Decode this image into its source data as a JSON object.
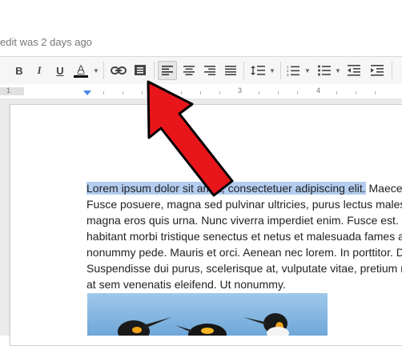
{
  "header": {
    "last_edit": "edit was 2 days ago"
  },
  "toolbar": {
    "bold_label": "B",
    "italic_label": "I",
    "underline_label": "U",
    "text_color_label": "A",
    "text_color_bar": "#000000"
  },
  "ruler": {
    "numbers": [
      "1",
      "1",
      "2",
      "3",
      "4"
    ]
  },
  "document": {
    "selected_text": "Lorem ipsum dolor sit amet, consectetuer adipiscing elit.",
    "line1_rest": " Maecenas",
    "lines": [
      "Fusce posuere, magna sed pulvinar ultricies, purus lectus malesuada libero,",
      "magna eros quis urna. Nunc viverra imperdiet enim. Fusce est. Vivamus",
      "habitant morbi tristique senectus et netus et malesuada fames ac turpis",
      "nonummy pede. Mauris et orci. Aenean nec lorem. In porttitor. Donec",
      "Suspendisse dui purus, scelerisque at, vulputate vitae, pretium mattis,",
      "at sem venenatis eleifend. Ut nonummy."
    ]
  },
  "colors": {
    "selection": "#b4cdf0",
    "arrow_fill": "#e8161b",
    "arrow_stroke": "#000000",
    "ruler_marker": "#4a86e8"
  },
  "image": {
    "alt_semantic": "king-penguins-photo"
  }
}
